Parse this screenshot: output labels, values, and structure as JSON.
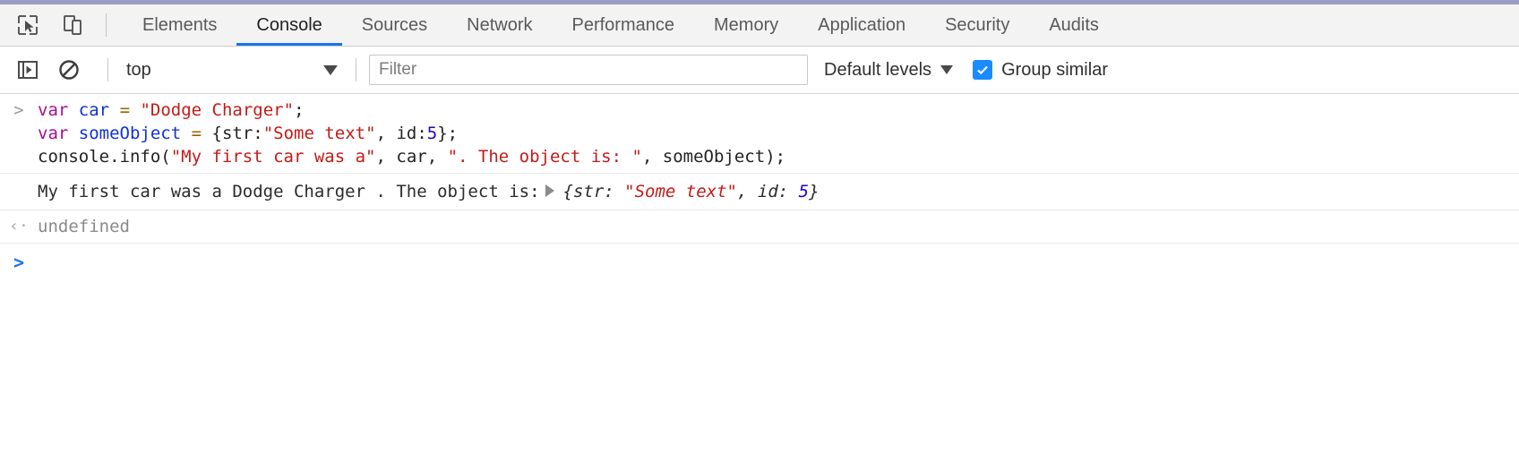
{
  "accent_color": "#9a9ec4",
  "tabbar": {
    "icons": [
      {
        "name": "inspect-element-icon",
        "title": "Inspect element"
      },
      {
        "name": "device-toolbar-icon",
        "title": "Toggle device toolbar"
      }
    ],
    "tabs": [
      {
        "label": "Elements",
        "active": false
      },
      {
        "label": "Console",
        "active": true
      },
      {
        "label": "Sources",
        "active": false
      },
      {
        "label": "Network",
        "active": false
      },
      {
        "label": "Performance",
        "active": false
      },
      {
        "label": "Memory",
        "active": false
      },
      {
        "label": "Application",
        "active": false
      },
      {
        "label": "Security",
        "active": false
      },
      {
        "label": "Audits",
        "active": false
      }
    ]
  },
  "toolbar": {
    "sidebar_toggle_icon": "console-sidebar-icon",
    "clear_icon": "clear-console-icon",
    "context": "top",
    "filter_placeholder": "Filter",
    "filter_value": "",
    "levels_label": "Default levels",
    "group_similar_label": "Group similar",
    "group_similar_checked": true,
    "checkbox_color": "#1a8cff",
    "active_tab_underline": "#1a73e8"
  },
  "console": {
    "input": {
      "marker": ">",
      "line1": {
        "kw": "var",
        "ident": "car",
        "op": "=",
        "str": "\"Dodge Charger\"",
        "end": ";"
      },
      "line2": {
        "kw": "var",
        "ident": "someObject",
        "op": "=",
        "open": "{str:",
        "str": "\"Some text\"",
        "mid": ", id:",
        "num": "5",
        "end": "};"
      },
      "line3": {
        "call": "console.info(",
        "str1": "\"My first car was a\"",
        "arg1": ", car, ",
        "str2": "\". The object is: \"",
        "arg2": ", someObject);"
      }
    },
    "output": {
      "text": "My first car was a Dodge Charger . The object is:",
      "expander": "▶",
      "object": {
        "open": "{",
        "key1": "str: ",
        "val1": "\"Some text\"",
        "sep": ", ",
        "key2": "id: ",
        "val2": "5",
        "close": "}"
      }
    },
    "return": {
      "marker": "‹·",
      "value": "undefined"
    },
    "prompt": {
      "marker": ">",
      "value": ""
    }
  }
}
